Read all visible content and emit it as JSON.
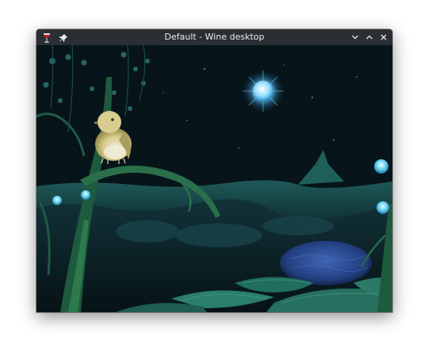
{
  "window": {
    "title": "Default - Wine desktop",
    "icons": {
      "app": "wine-glass-icon",
      "pin": "pin-icon",
      "minimize": "chevron-down-icon",
      "maximize": "chevron-up-icon",
      "close": "close-icon"
    }
  },
  "colors": {
    "titlebar": "#2b2f33",
    "title_text": "#e9eaeb",
    "sky": "#07141a",
    "moon": "#bfefff",
    "bird": "#cfc37f",
    "foliage": "#1d6b63"
  }
}
